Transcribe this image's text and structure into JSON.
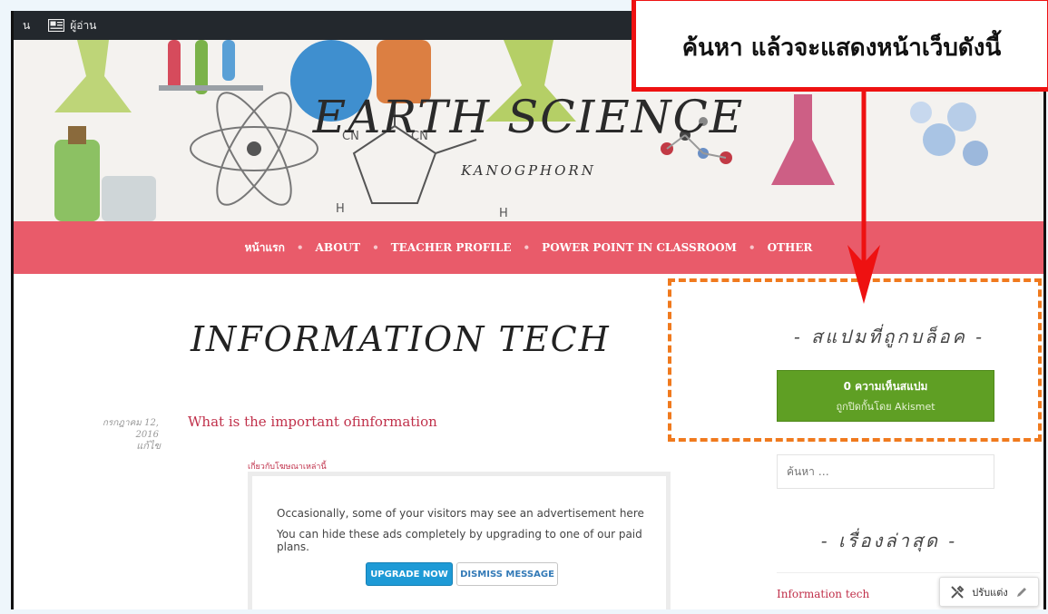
{
  "admin_bar": {
    "left_text": "น",
    "reader_label": "ผู้อ่าน"
  },
  "site": {
    "title": "EARTH SCIENCE",
    "description": "KANOGPHORN"
  },
  "nav": {
    "items": [
      "หน้าแรก",
      "ABOUT",
      "TEACHER PROFILE",
      "POWER POINT IN CLASSROOM",
      "OTHER"
    ]
  },
  "page": {
    "title": "INFORMATION TECH"
  },
  "post": {
    "date": "กรกฎาคม 12, 2016",
    "edit": "แก้ไข",
    "title": "What is the important ofinformation"
  },
  "ad": {
    "label": "เกี่ยวกับโฆษณาเหล่านี้",
    "line1": "Occasionally, some of your visitors may see an advertisement here",
    "line2": "You can hide these ads completely by upgrading to one of our paid plans.",
    "upgrade_button": "UPGRADE NOW",
    "dismiss_button": "DISMISS MESSAGE"
  },
  "sidebar": {
    "spam_title": "- สแปมที่ถูกบล็อค -",
    "akismet_line1": "0 ความเห็นสแปม",
    "akismet_line2": "ถูกปิดกั้นโดย Akismet",
    "search_placeholder": "ค้นหา …",
    "recent_title": "- เรื่องล่าสุด -",
    "recent_items": [
      "Information tech"
    ]
  },
  "customize": {
    "label": "ปรับแต่ง"
  },
  "annotation": {
    "text": "ค้นหา แล้วจะแสดงหน้าเว็บดังนี้"
  },
  "colors": {
    "nav_bg": "#e95b6a",
    "akismet_green": "#5f9f24",
    "link": "#c0304a",
    "annotation_red": "#ee1111",
    "dashed_orange": "#f07a1e",
    "upgrade_blue": "#1e9ad6"
  },
  "icons": [
    "reader-icon",
    "wrench-icon",
    "pencil-icon"
  ]
}
